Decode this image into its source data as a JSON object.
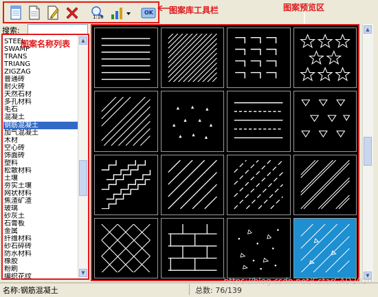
{
  "annotations": {
    "toolbar_label": "图案库工具栏",
    "preview_label": "图案预览区",
    "list_label": "图案名称列表"
  },
  "colors": {
    "annotation_red": "#e0191b",
    "selection_blue": "#3169c6",
    "selected_pattern_bg": "#1e8fd0"
  },
  "toolbar": {
    "icons": [
      "new-document-icon",
      "document-icon",
      "edit-icon",
      "delete-x-icon",
      "zoom-scale-icon",
      "bar-chart-icon",
      "dropdown-arrow-icon",
      "ok-icon"
    ],
    "zoom_text": "1:10",
    "ok_text": "OK"
  },
  "search": {
    "label": "搜索:",
    "value": ""
  },
  "pattern_list": {
    "items": [
      "STEEL",
      "SWAMP",
      "TRANS",
      "TRIANG",
      "ZIGZAG",
      "普通砖",
      "耐火砖",
      "天然石材",
      "多孔材料",
      "毛石",
      "混凝土",
      "钢筋混凝土",
      "加气混凝土",
      "木材",
      "空心砖",
      "饰面砖",
      "塑料",
      "松散材料",
      "土壤",
      "夯实土壤",
      "网状材料",
      "焦渣矿渣",
      "玻璃",
      "砂灰土",
      "石膏板",
      "金属",
      "纤维材料",
      "砂石碎砖",
      "防水材料",
      "橡胶",
      "粉刷",
      "编织花纹"
    ],
    "selected_index": 11
  },
  "preview": {
    "selected_index": 15
  },
  "status": {
    "name_label": "名称:",
    "name_value": "钢筋混凝土",
    "total_label": "总数:",
    "total_value": "76/139"
  },
  "watermark": "https://blog.csdn.net/CstarCAD2020"
}
